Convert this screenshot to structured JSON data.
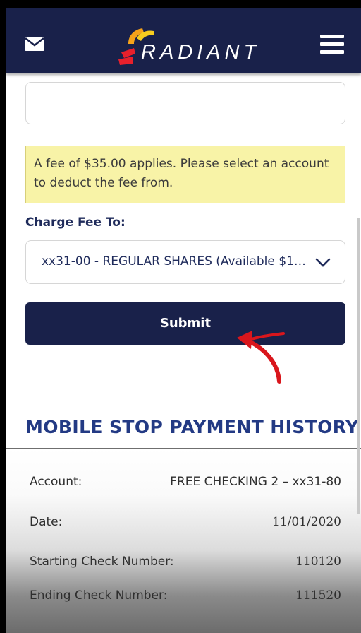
{
  "header": {
    "brand": "RADIANT",
    "icons": {
      "mail": "mail-icon",
      "menu": "hamburger-menu-icon",
      "logo": "radiant-logo-mark"
    },
    "colors": {
      "navy": "#19214a",
      "logo_red": "#e8202c",
      "logo_orange": "#f5a21a",
      "logo_yellow": "#f7cc1f"
    }
  },
  "form": {
    "top_field_value": "",
    "fee_notice": "A fee of $35.00 applies. Please select an account to deduct the fee from.",
    "charge_fee_label": "Charge Fee To:",
    "charge_fee_selected": "xx31-00 - REGULAR SHARES (Available $11…",
    "submit_label": "Submit"
  },
  "history": {
    "title": "MOBILE STOP PAYMENT HISTORY",
    "rows": [
      {
        "label": "Account:",
        "value": "FREE CHECKING 2 – xx31-80"
      },
      {
        "label": "Date:",
        "value": "11/01/2020"
      },
      {
        "label": "Starting Check Number:",
        "value": "110120"
      },
      {
        "label": "Ending Check Number:",
        "value": "111520"
      }
    ]
  },
  "annotation": {
    "arrow_color": "#d9161c"
  }
}
